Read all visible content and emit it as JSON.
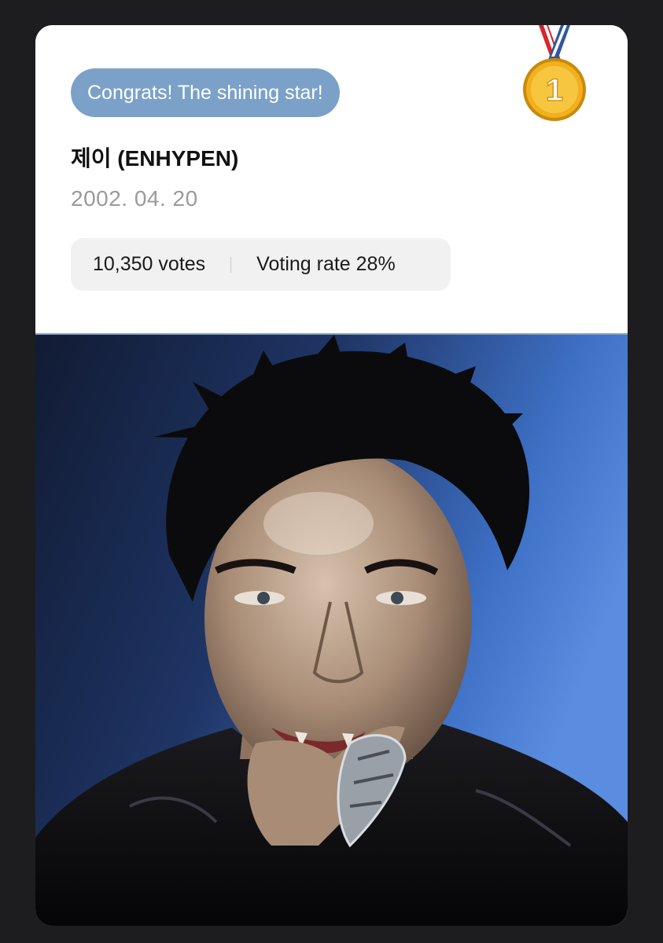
{
  "badge": {
    "text": "Congrats! The shining star!"
  },
  "rank": {
    "icon": "first-place-medal-icon",
    "number": "1"
  },
  "artist": {
    "name": "제이 (ENHYPEN)",
    "birthdate": "2002. 04. 20"
  },
  "stats": {
    "votes": "10,350 votes",
    "voting_rate": "Voting rate 28%"
  },
  "photo": {
    "subject": "artist-portrait"
  },
  "colors": {
    "badge_bg": "#7ba1c8",
    "page_bg": "#1d1d1f",
    "stats_bg": "#f1f1f2",
    "date_text": "#9a9a9a",
    "medal_gold": "#f2b01e"
  }
}
